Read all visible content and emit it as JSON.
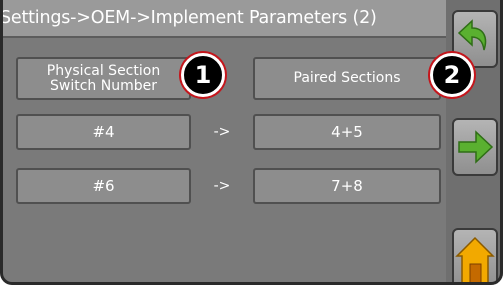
{
  "header": {
    "title": "Settings->OEM->Implement Parameters (2)"
  },
  "table": {
    "col1_header": "Physical Section\nSwitch Number",
    "col2_header": "Paired Sections",
    "rows": [
      {
        "switch": "#4",
        "arrow": "->",
        "paired": "4+5"
      },
      {
        "switch": "#6",
        "arrow": "->",
        "paired": "7+8"
      }
    ]
  },
  "callouts": {
    "one": "1",
    "two": "2"
  },
  "sidebar": {
    "back_icon": "back-arrow-icon",
    "next_icon": "next-arrow-icon",
    "home_icon": "home-icon"
  },
  "colors": {
    "background": "#7a7a7a",
    "title_bar": "#9a9a9a",
    "arrow_green": "#5ab030",
    "callout_ring": "#c4161c"
  }
}
